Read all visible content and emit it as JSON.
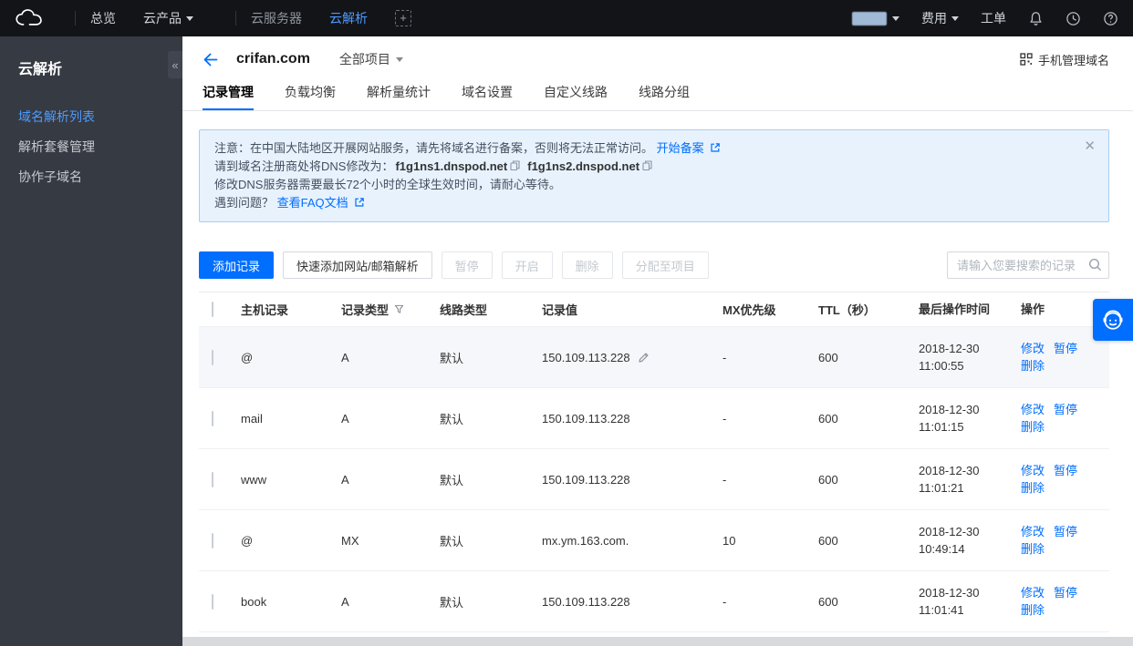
{
  "colors": {
    "accent": "#006eff",
    "notice_bg": "#e7f2fd",
    "notice_border": "#a9cdf3",
    "topbar_bg": "#131418",
    "sidebar_bg": "#363a43"
  },
  "topbar": {
    "overview": "总览",
    "products": "云产品",
    "tab_cvm": "云服务器",
    "tab_dns": "云解析",
    "billing": "费用",
    "tickets": "工单"
  },
  "sidebar": {
    "title": "云解析",
    "collapse": "«",
    "items": [
      {
        "label": "域名解析列表"
      },
      {
        "label": "解析套餐管理"
      },
      {
        "label": "协作子域名"
      }
    ]
  },
  "header": {
    "domain": "crifan.com",
    "project": "全部项目",
    "mobile_manage": "手机管理域名"
  },
  "tabs": [
    "记录管理",
    "负载均衡",
    "解析量统计",
    "域名设置",
    "自定义线路",
    "线路分组"
  ],
  "notice": {
    "line1": "注意：在中国大陆地区开展网站服务，请先将域名进行备案，否则将无法正常访问。",
    "line1_link": "开始备案",
    "line2_prefix": "请到域名注册商处将DNS修改为：",
    "dns1": "f1g1ns1.dnspod.net",
    "dns2": "f1g1ns2.dnspod.net",
    "line3": "修改DNS服务器需要最长72个小时的全球生效时间，请耐心等待。",
    "line4_prefix": "遇到问题？",
    "line4_link": "查看FAQ文档",
    "close": "✕"
  },
  "toolbar": {
    "add": "添加记录",
    "quick_add": "快速添加网站/邮箱解析",
    "pause": "暂停",
    "start": "开启",
    "delete": "删除",
    "assign": "分配至项目",
    "search_placeholder": "请输入您要搜索的记录"
  },
  "table": {
    "headers": {
      "host": "主机记录",
      "type": "记录类型",
      "line": "线路类型",
      "value": "记录值",
      "mx": "MX优先级",
      "ttl": "TTL（秒）",
      "time": "最后操作时间",
      "action": "操作"
    },
    "actions": {
      "edit": "修改",
      "pause": "暂停",
      "delete": "删除"
    },
    "rows": [
      {
        "host": "@",
        "type": "A",
        "line": "默认",
        "value": "150.109.113.228",
        "mx": "-",
        "ttl": "600",
        "date": "2018-12-30",
        "time": "11:00:55",
        "hovered": true
      },
      {
        "host": "mail",
        "type": "A",
        "line": "默认",
        "value": "150.109.113.228",
        "mx": "-",
        "ttl": "600",
        "date": "2018-12-30",
        "time": "11:01:15"
      },
      {
        "host": "www",
        "type": "A",
        "line": "默认",
        "value": "150.109.113.228",
        "mx": "-",
        "ttl": "600",
        "date": "2018-12-30",
        "time": "11:01:21"
      },
      {
        "host": "@",
        "type": "MX",
        "line": "默认",
        "value": "mx.ym.163.com.",
        "mx": "10",
        "ttl": "600",
        "date": "2018-12-30",
        "time": "10:49:14"
      },
      {
        "host": "book",
        "type": "A",
        "line": "默认",
        "value": "150.109.113.228",
        "mx": "-",
        "ttl": "600",
        "date": "2018-12-30",
        "time": "11:01:41"
      }
    ]
  }
}
